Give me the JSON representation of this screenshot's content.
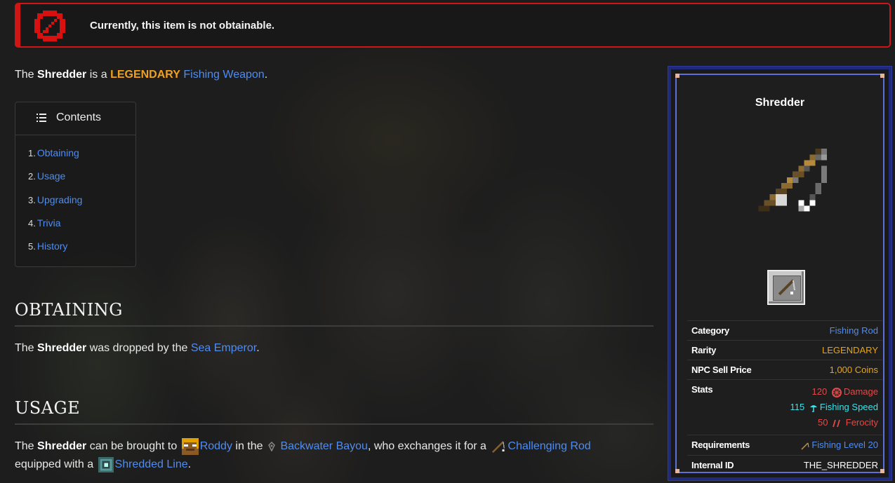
{
  "banner": {
    "text": "Currently, this item is not obtainable.",
    "icon": "no-entry-icon",
    "color": "#d01515"
  },
  "intro": {
    "prefix": "The ",
    "item": "Shredder",
    "mid": " is a ",
    "rarity": "LEGENDARY",
    "space": " ",
    "type_link": "Fishing Weapon",
    "suffix": "."
  },
  "toc": {
    "title": "Contents",
    "items": [
      {
        "num": "1.",
        "label": "Obtaining"
      },
      {
        "num": "2.",
        "label": "Usage"
      },
      {
        "num": "3.",
        "label": "Upgrading"
      },
      {
        "num": "4.",
        "label": "Trivia"
      },
      {
        "num": "5.",
        "label": "History"
      }
    ]
  },
  "obtaining": {
    "heading": "OBTAINING",
    "prefix": "The ",
    "item": "Shredder",
    "mid": " was dropped by the ",
    "link": "Sea Emperor",
    "suffix": "."
  },
  "usage": {
    "heading": "USAGE",
    "p1": "The ",
    "item": "Shredder",
    "p2": " can be brought to ",
    "npc": "Roddy",
    "p3": " in the ",
    "place": "Backwater Bayou",
    "p4": ", who exchanges it for a ",
    "rod": "Challenging Rod",
    "line2a": "equipped with a ",
    "line_link": "Shredded Line",
    "line2b": "."
  },
  "infobox": {
    "title": "Shredder",
    "rows": {
      "category": {
        "label": "Category",
        "value": "Fishing Rod"
      },
      "rarity": {
        "label": "Rarity",
        "value": "LEGENDARY"
      },
      "sell": {
        "label": "NPC Sell Price",
        "value": "1,000 Coins"
      },
      "stats": {
        "label": "Stats",
        "damage_val": "120",
        "damage_name": "Damage",
        "speed_val": "115",
        "speed_name": "Fishing Speed",
        "ferocity_val": "50",
        "ferocity_name": "Ferocity"
      },
      "requirements": {
        "label": "Requirements",
        "value": "Fishing Level 20"
      },
      "internal_id": {
        "label": "Internal ID",
        "value": "THE_SHREDDER"
      }
    },
    "colors": {
      "frame": "#1f2a7a",
      "frame_light": "#5e6fd8",
      "legendary": "#e8a418",
      "link": "#4f8cf0"
    }
  }
}
